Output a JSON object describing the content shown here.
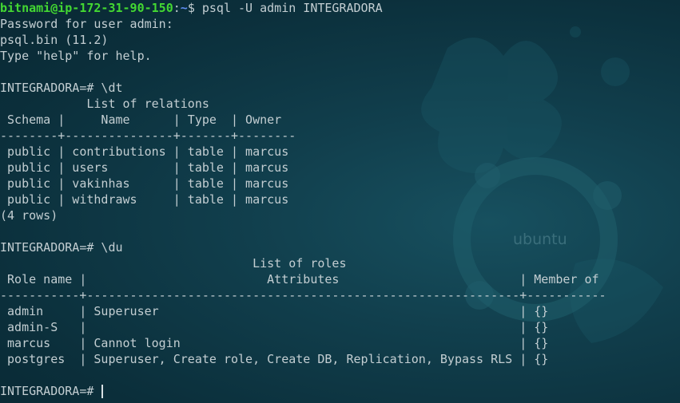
{
  "colors": {
    "background": "#0d3542",
    "text": "#c3ced2",
    "prompt_user": "#43d832",
    "prompt_path": "#5e8df0"
  },
  "wallpaper": {
    "logo_icon": "ubuntu-circle-of-friends-icon",
    "logo_text": "ubuntu"
  },
  "shell": {
    "user_host": "bitnami@ip-172-31-90-150",
    "separator": ":",
    "path": "~",
    "symbol": "$ ",
    "command": "psql -U admin INTEGRADORA"
  },
  "output": {
    "password_prompt": "Password for user admin:",
    "version": "psql.bin (11.2)",
    "help_hint": "Type \"help\" for help."
  },
  "relations": {
    "command_line": "INTEGRADORA=# \\dt",
    "title_line": "            List of relations",
    "header_line": " Schema |     Name      | Type  | Owner",
    "divider_line": "--------+---------------+-------+--------",
    "rows": [
      " public | contributions | table | marcus",
      " public | users         | table | marcus",
      " public | vakinhas      | table | marcus",
      " public | withdraws     | table | marcus"
    ],
    "count_line": "(4 rows)"
  },
  "roles": {
    "command_line": "INTEGRADORA=# \\du",
    "title_line": "                                   List of roles",
    "header_line": " Role name |                         Attributes                         | Member of",
    "divider_line": "-----------+------------------------------------------------------------+-----------",
    "rows": [
      " admin     | Superuser                                                  | {}",
      " admin-S   |                                                            | {}",
      " marcus    | Cannot login                                               | {}",
      " postgres  | Superuser, Create role, Create DB, Replication, Bypass RLS | {}"
    ]
  },
  "current_prompt": "INTEGRADORA=# "
}
